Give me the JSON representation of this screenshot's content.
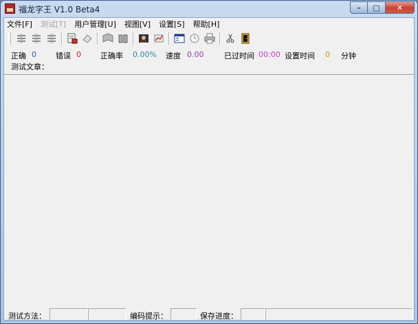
{
  "window": {
    "title": "福龙字王 V1.0 Beta4",
    "controls": {
      "minimize": "–",
      "maximize": "□",
      "close": "✕"
    }
  },
  "menu": [
    {
      "label": "文件[F]",
      "enabled": true
    },
    {
      "label": "测试[T]",
      "enabled": false
    },
    {
      "label": "用户管理[U]",
      "enabled": true
    },
    {
      "label": "视图[V]",
      "enabled": true
    },
    {
      "label": "设置[S]",
      "enabled": true
    },
    {
      "label": "帮助[H]",
      "enabled": true
    }
  ],
  "toolbar": {
    "icons": [
      "list-icon-1",
      "list-icon-2",
      "list-icon-3",
      "document-icon",
      "eraser-icon",
      "book-icon-1",
      "book-icon-2",
      "user-photo-icon",
      "chart-icon",
      "window-icon",
      "clock-icon",
      "printer-icon",
      "scissors-icon",
      "exit-door-icon"
    ]
  },
  "stats": {
    "correct_label": "正确",
    "correct_value": "0",
    "error_label": "错误",
    "error_value": "0",
    "accuracy_label": "正确率",
    "accuracy_value": "0.00%",
    "speed_label": "速度",
    "speed_value": "0.00",
    "elapsed_label": "已过时间",
    "elapsed_value": "00:00",
    "set_time_label": "设置时间",
    "set_time_value": "0",
    "minute_unit": "分钟"
  },
  "article_label": "测试文章：",
  "statusbar": {
    "method_label": "测试方法：",
    "encoding_label": "编码提示：",
    "save_label": "保存进度："
  },
  "colors": {
    "blue": "#1c5fd1",
    "red": "#d01a1a",
    "teal": "#2c8aa6",
    "purple": "#9b3bb4",
    "magenta": "#c73fc0",
    "gold": "#c69a10"
  }
}
